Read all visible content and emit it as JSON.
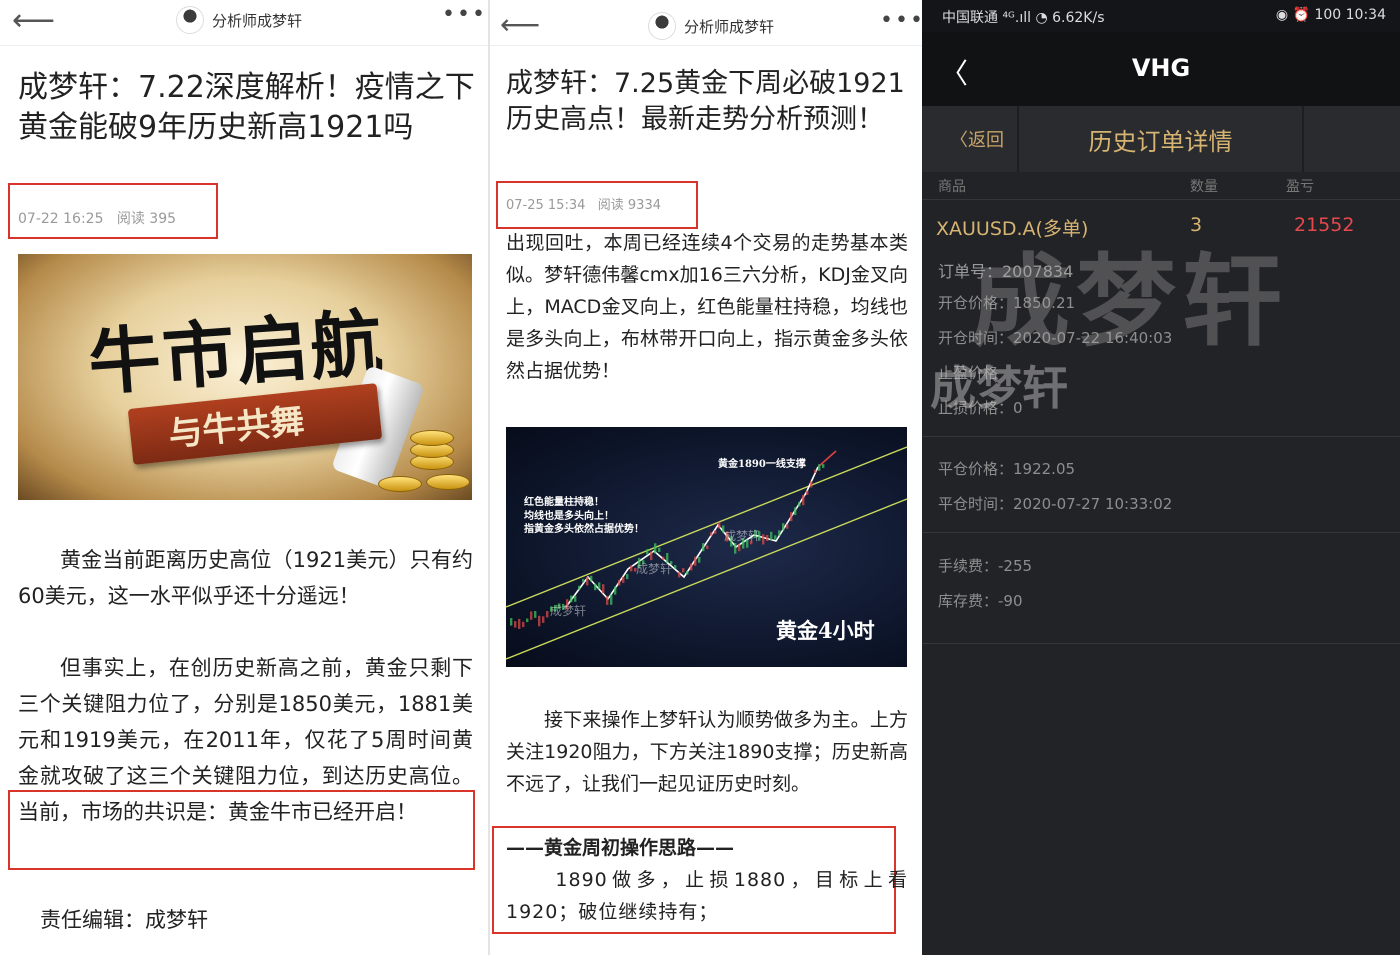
{
  "left_article": {
    "author": "分析师成梦轩",
    "title": "成梦轩：7.22深度解析！疫情之下黄金能破9年历史新高1921吗",
    "meta_time": "07-22 16:25",
    "meta_reads": "阅读 395",
    "banner_main": "牛市启航",
    "banner_ribbon": "与牛共舞",
    "para1": "黄金当前距离历史高位（1921美元）只有约60美元，这一水平似乎还十分遥远！",
    "para2": "但事实上，在创历史新高之前，黄金只剩下三个关键阻力位了，分别是1850美元，1881美元和1919美元，在2011年，仅花了5周时间黄金就攻破了这三个关键阻力位，到达历史高位。当前，市场的共识是：黄金牛市已经开启！",
    "editor": "责任编辑：成梦轩"
  },
  "middle_article": {
    "author": "分析师成梦轩",
    "title": "成梦轩：7.25黄金下周必破1921历史高点！最新走势分析预测！",
    "meta_time": "07-25 15:34",
    "meta_reads": "阅读 9334",
    "para1": "出现回吐，本周已经连续4个交易的走势基本类似。梦轩德伟馨cmx加16三六分析，KDJ金叉向上，MACD金叉向上，红色能量柱持稳，均线也是多头向上，布林带开口向上，指示黄金多头依然占据优势！",
    "para2": "接下来操作上梦轩认为顺势做多为主。上方关注1920阻力，下方关注1890支撑；历史新高不远了，让我们一起见证历史时刻。",
    "strategy_title": "——黄金周初操作思路——",
    "strategy_body": "1890做多，止损1880，目标上看1920；破位继续持有；"
  },
  "chart_data": {
    "type": "line",
    "title": "黄金4小时",
    "annotations": [
      "黄金1890一线支撑",
      "红色能量柱持稳！",
      "均线也是多头向上！",
      "指黄金多头依然占据优势！"
    ],
    "watermark": "成梦轩"
  },
  "trade_app": {
    "status_left": "中国联通 ⁴ᴳ.ıll ◔ 6.62K/s",
    "status_right": "◉ ⏰ 100 10:34",
    "app_title": "VHG",
    "back_label": "〈返回",
    "page_heading": "历史订单详情",
    "col_product": "商品",
    "col_qty": "数量",
    "col_pnl": "盈亏",
    "symbol": "XAUUSD.A(多单)",
    "qty": "3",
    "pnl": "21552",
    "order_no": "订单号：2007834",
    "open_price": "开仓价格：1850.21",
    "open_time": "开仓时间：2020-07-22 16:40:03",
    "tp": "止盈价格",
    "sl": "止损价格：0",
    "close_price": "平仓价格：1922.05",
    "close_time": "平仓时间：2020-07-27 10:33:02",
    "fee": "手续费：-255",
    "swap": "库存费：-90",
    "watermark": "成梦轩",
    "colors": {
      "bg": "#222326",
      "accent": "#d7b472",
      "profit": "#e5484d"
    }
  }
}
